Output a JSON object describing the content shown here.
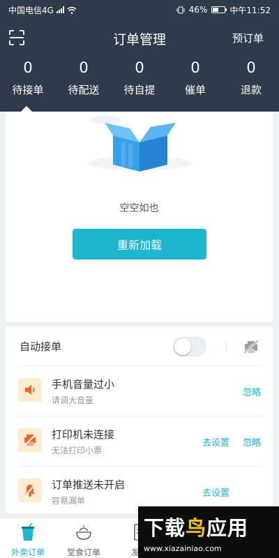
{
  "status_bar": {
    "carrier": "中国电信4G",
    "network_sup": "4G",
    "battery": "46%",
    "battery_level": 0.46,
    "time": "中午11:52"
  },
  "header": {
    "title": "订单管理",
    "right_action": "预订单"
  },
  "stats": [
    {
      "count": "0",
      "label": "待接单"
    },
    {
      "count": "0",
      "label": "待配送"
    },
    {
      "count": "0",
      "label": "待自提"
    },
    {
      "count": "0",
      "label": "催单"
    },
    {
      "count": "0",
      "label": "退款"
    }
  ],
  "empty_state": {
    "text": "空空如也",
    "reload_label": "重新加载"
  },
  "auto_accept": {
    "label": "自动接单",
    "enabled": false
  },
  "alerts": [
    {
      "icon": "speaker-icon",
      "title": "手机音量过小",
      "subtitle": "请调大音量",
      "actions": [
        "忽略"
      ]
    },
    {
      "icon": "printer-off-icon",
      "title": "打印机未连接",
      "subtitle": "无法打印小票",
      "actions": [
        "去设置",
        "忽略"
      ]
    },
    {
      "icon": "bell-off-icon",
      "title": "订单推送未开启",
      "subtitle": "容易漏单",
      "actions": [
        "去设置"
      ]
    }
  ],
  "bottom_nav": [
    {
      "label": "外卖订单",
      "active": true
    },
    {
      "label": "堂食订单",
      "active": false
    },
    {
      "label": "发单",
      "active": false
    }
  ],
  "watermark": {
    "brand_part1": "下载",
    "brand_part2": "鸟",
    "brand_part3": "应用",
    "url": "www.xiazainiao.com"
  },
  "colors": {
    "header": "#2f3b4b",
    "accent": "#1db6cf",
    "alert_bg": "#fdecd0",
    "alert_icon": "#e8662f"
  }
}
